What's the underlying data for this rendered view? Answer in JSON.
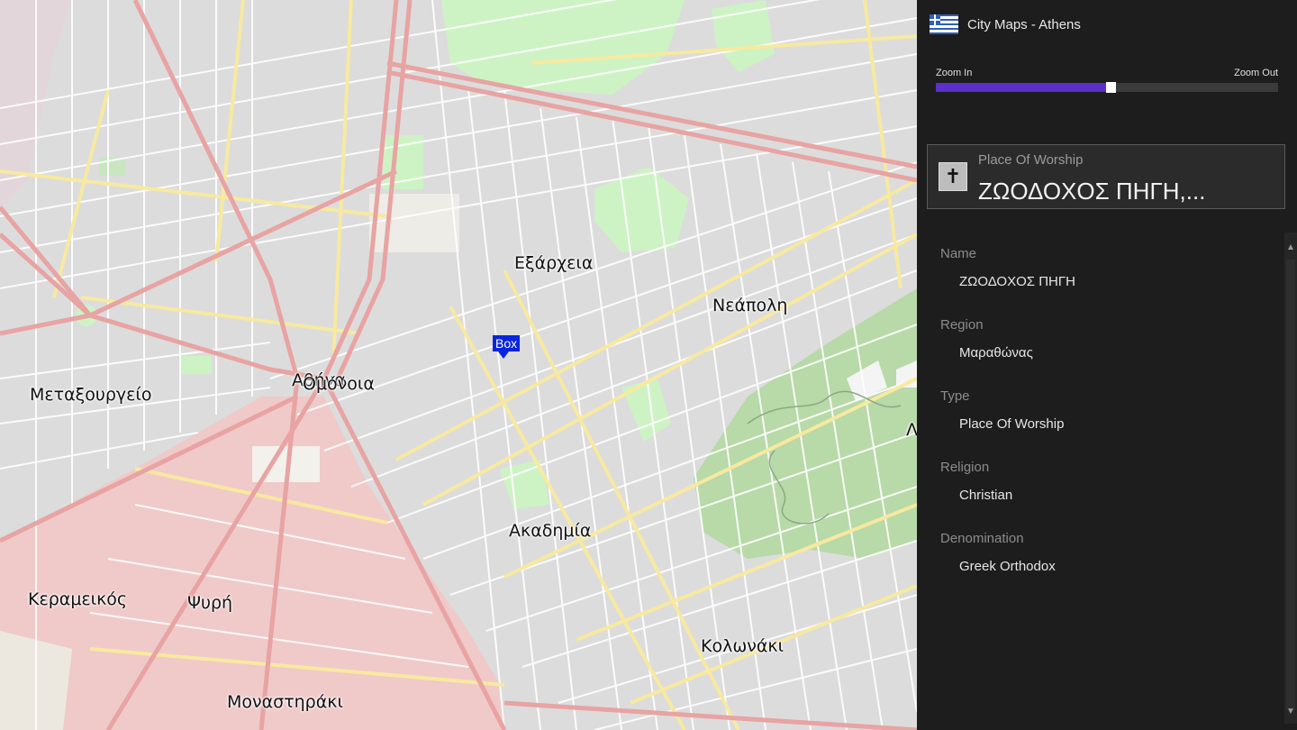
{
  "app": {
    "title": "City Maps - Athens"
  },
  "zoom": {
    "in_label": "Zoom In",
    "out_label": "Zoom Out",
    "level_fraction": 0.51
  },
  "map": {
    "labels": [
      {
        "name": "exarcheia",
        "text": "Εξάρχεια"
      },
      {
        "name": "neapoli",
        "text": "Νεάπολη"
      },
      {
        "name": "metaxourgeio",
        "text": "Μεταξουργείο"
      },
      {
        "name": "athina",
        "text": "Αθήνα"
      },
      {
        "name": "omonoia",
        "text": "Ομόνοια"
      },
      {
        "name": "akadimia",
        "text": "Ακαδημία"
      },
      {
        "name": "kerameikos",
        "text": "Κεραμεικός"
      },
      {
        "name": "psyri",
        "text": "Ψυρή"
      },
      {
        "name": "kolonaki",
        "text": "Κολωνάκι"
      },
      {
        "name": "monastiraki",
        "text": "Μοναστηράκι"
      },
      {
        "name": "edge",
        "text": "Λ"
      }
    ],
    "pin": {
      "label": "Box"
    }
  },
  "poi": {
    "category": "Place Of Worship",
    "name": "ΖΩΟΔΟΧΟΣ ΠΗΓΗ,...",
    "icon": "cross-icon"
  },
  "details": [
    {
      "label": "Name",
      "value": "ΖΩΟΔΟΧΟΣ ΠΗΓΗ"
    },
    {
      "label": "Region",
      "value": "Μαραθώνας"
    },
    {
      "label": "Type",
      "value": "Place Of Worship"
    },
    {
      "label": "Religion",
      "value": "Christian"
    },
    {
      "label": "Denomination",
      "value": "Greek Orthodox"
    }
  ],
  "colors": {
    "accent": "#5b2fc9",
    "pin": "#0a24e0",
    "panel": "#1d1d1d",
    "park": "#b8d9a8",
    "pedestrian": "#f0c9c9"
  }
}
